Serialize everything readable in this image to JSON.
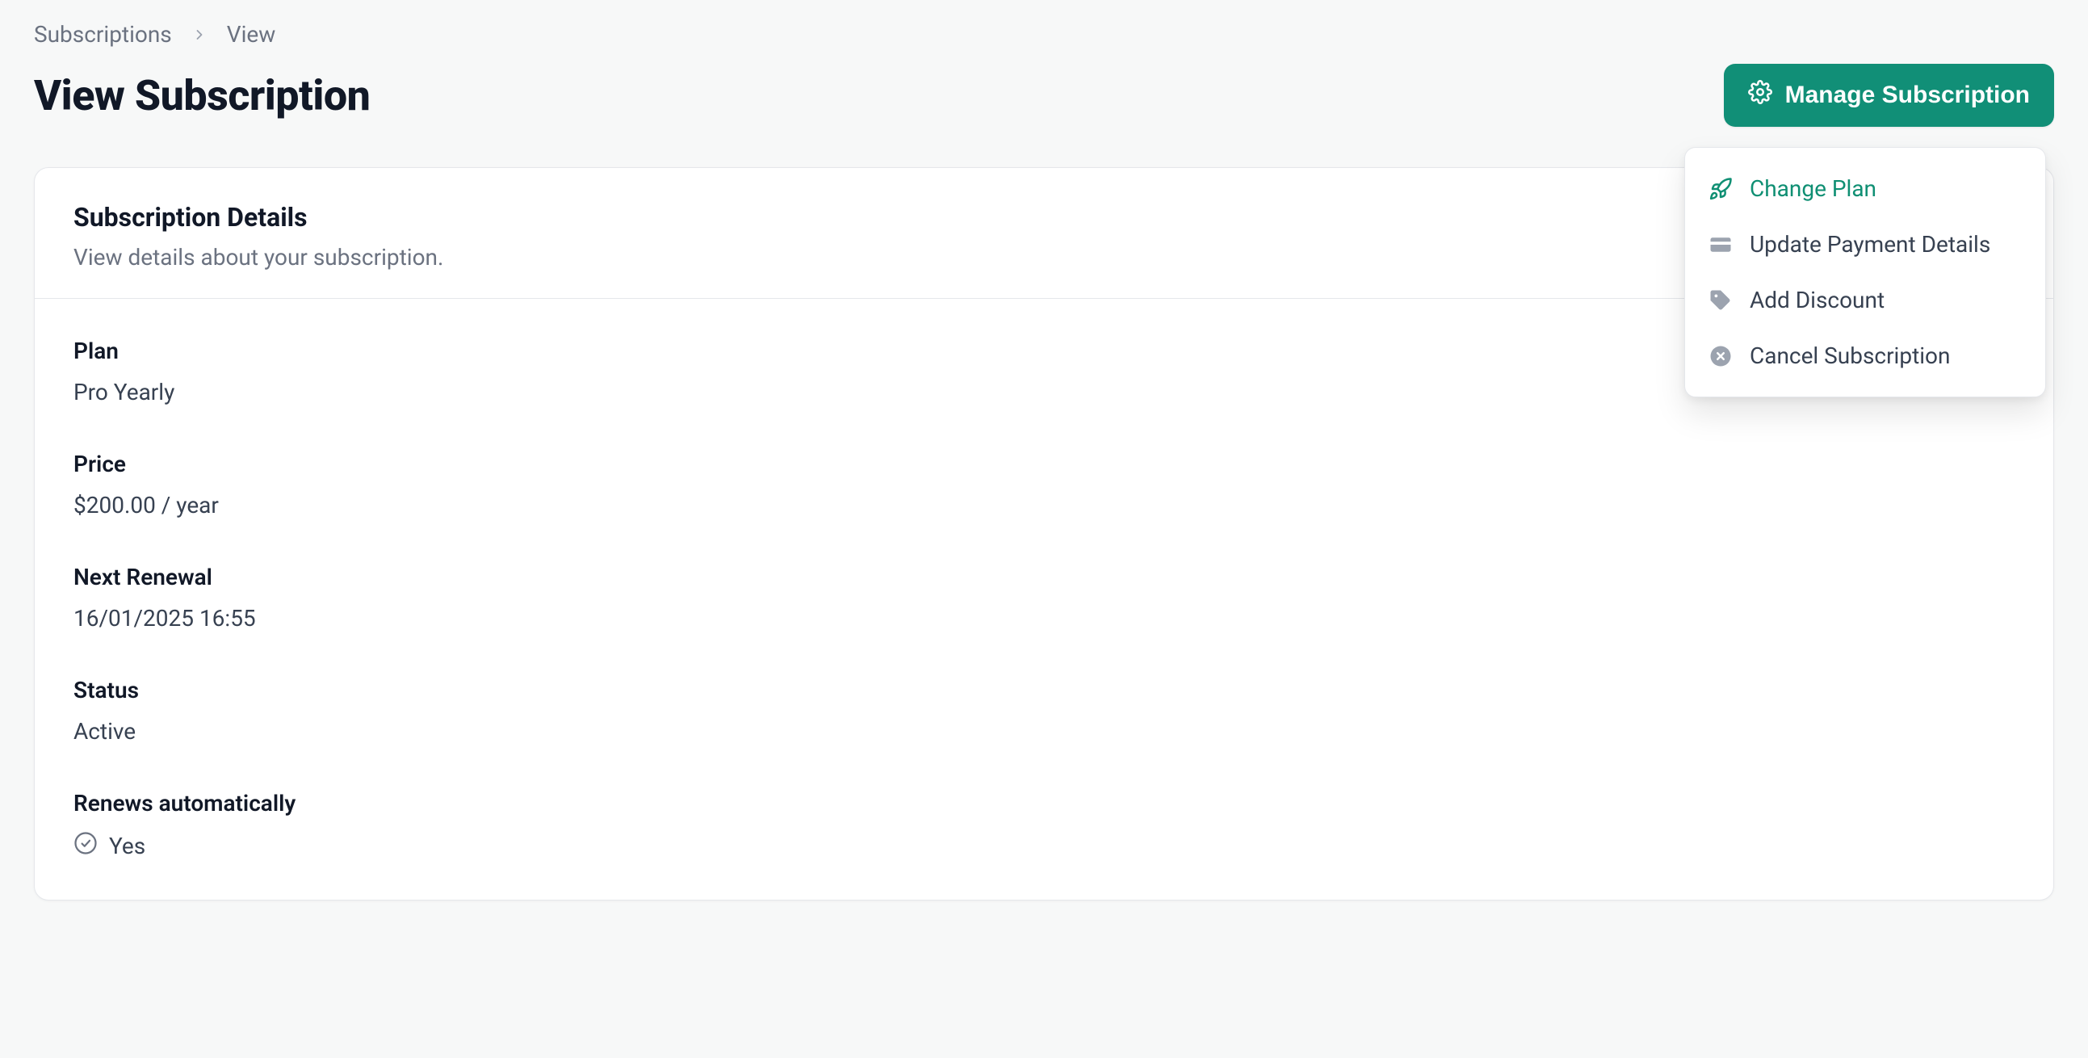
{
  "breadcrumb": {
    "root": "Subscriptions",
    "current": "View"
  },
  "header": {
    "title": "View Subscription",
    "manage_label": "Manage Subscription"
  },
  "card": {
    "title": "Subscription Details",
    "subtitle": "View details about your subscription."
  },
  "fields": {
    "plan_label": "Plan",
    "plan_value": "Pro Yearly",
    "price_label": "Price",
    "price_value": "$200.00 / year",
    "renewal_label": "Next Renewal",
    "renewal_value": "16/01/2025 16:55",
    "status_label": "Status",
    "status_value": "Active",
    "autorenew_label": "Renews automatically",
    "autorenew_value": "Yes"
  },
  "dropdown": {
    "change_plan": "Change Plan",
    "update_payment": "Update Payment Details",
    "add_discount": "Add Discount",
    "cancel_subscription": "Cancel Subscription"
  },
  "colors": {
    "accent": "#118f77"
  }
}
